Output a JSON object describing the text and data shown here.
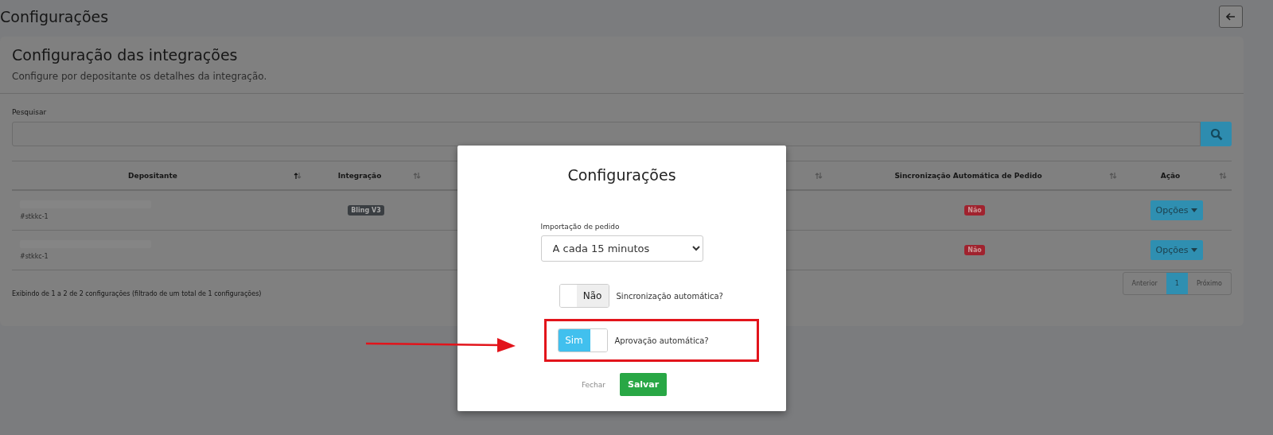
{
  "page": {
    "title": "Configurações"
  },
  "card": {
    "title": "Configuração das integrações",
    "subtitle": "Configure por depositante os detalhes da integração.",
    "search_label": "Pesquisar",
    "columns": [
      {
        "label": "Depositante",
        "sorted": true
      },
      {
        "label": "Integração",
        "sorted": false
      },
      {
        "sorted": false
      },
      {
        "label": "Sincronização Automática de Pedido",
        "sorted": false
      },
      {
        "label": "Ação",
        "sorted": false
      }
    ],
    "rows": [
      {
        "code": "#stkkc-1",
        "integration": "Bling V3",
        "sync": "Não",
        "action": "Opções"
      },
      {
        "code": "#stkkc-1",
        "sync": "Não",
        "action": "Opções"
      }
    ],
    "footer": "Exibindo de 1 a 2 de 2 configurações (filtrado de um total de 1 configurações)",
    "pagination": [
      {
        "label": "Anterior",
        "selected": false
      },
      {
        "label": "1",
        "selected": true
      },
      {
        "label": "Próximo",
        "selected": false
      }
    ]
  },
  "modal": {
    "title": "Configurações",
    "select_label": "Importação de pedido",
    "select_value": "A cada 15 minutos",
    "toggles": [
      {
        "state_text": "Não",
        "on": false,
        "label": "Sincronização automática?",
        "highlighted": false
      },
      {
        "state_text": "Sim",
        "on": true,
        "label": "Aprovação automática?",
        "highlighted": true
      }
    ],
    "buttons": [
      {
        "kind": "link",
        "label": "Fechar"
      },
      {
        "kind": "primary",
        "label": "Salvar"
      }
    ]
  }
}
